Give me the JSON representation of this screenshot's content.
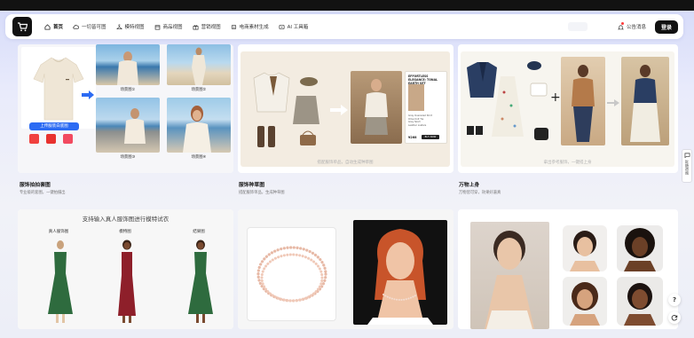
{
  "nav": {
    "items": [
      {
        "label": "首页",
        "icon": "home-icon",
        "active": true
      },
      {
        "label": "一切皆可图",
        "icon": "cloud-icon"
      },
      {
        "label": "模特视图",
        "icon": "hanger-icon"
      },
      {
        "label": "商品视图",
        "icon": "box-icon"
      },
      {
        "label": "营销视图",
        "icon": "gift-icon"
      },
      {
        "label": "电商素材生成",
        "icon": "layers-icon"
      },
      {
        "label": "AI 工具箱",
        "icon": "ai-icon"
      }
    ],
    "notice_label": "公告消息",
    "login_label": "登录"
  },
  "cards": {
    "clothing_shot": {
      "title": "服饰拍拍套图",
      "subtitle": "专业级的套图，一键拍摄出",
      "scene_captions": [
        "场景图①",
        "场景图②",
        "场景图③",
        "场景图④"
      ],
      "upload_label": "上传服装白底图"
    },
    "clothing_sketch": {
      "title": "服饰种草图",
      "subtitle": "搭配服饰单品，生成种草图",
      "hint": "搭配服饰单品，自动生成种草图",
      "product_card": {
        "heading": "EFFORTLESS ELEGANCE: TONAL EARTH SET",
        "bullets": [
          "Gray Oversized Shirt",
          "Olive Knit Tie",
          "Grey Skort",
          "Leather Loafers"
        ],
        "price": "¥268",
        "buy_label": "BUY NOW"
      }
    },
    "try_on": {
      "title": "万物上身",
      "subtitle": "万物皆可穿，效果好逼真",
      "hint": "拿出参考服饰，一键搭上身"
    },
    "model_tryon": {
      "headline": "支持输入真人服饰图进行模特试衣",
      "labels": [
        "真人服饰图",
        "模特图",
        "结果图"
      ]
    }
  },
  "side": {
    "feedback_label": "反馈咨询",
    "help_label": "?"
  },
  "colors": {
    "accent": "#2c6bf3",
    "brand": "#111111",
    "badge": "#ff3b3b"
  }
}
